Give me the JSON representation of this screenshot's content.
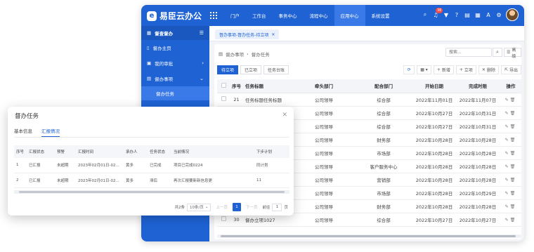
{
  "app": {
    "brand": "易臣云办公",
    "logo_letter": "e",
    "nav": [
      "门户",
      "工作台",
      "事务中心",
      "流程中心",
      "应用中心",
      "系统设置"
    ],
    "nav_active_index": 4,
    "notification_count": "36"
  },
  "sidebar": {
    "head": "督查督办",
    "items": [
      {
        "label": "督办主页"
      },
      {
        "label": "我的审批"
      },
      {
        "label": "督办事项"
      }
    ],
    "sub_item": "督办任务"
  },
  "tabstrip": {
    "tab": "督办事项-督办任务-待立项"
  },
  "content": {
    "breadcrumb": [
      "督办事项",
      "督办任务"
    ],
    "search_placeholder": "搜索...",
    "advanced": "高级",
    "subtabs": [
      "待立项",
      "已立项",
      "任务台账"
    ],
    "actions": {
      "new": "新增",
      "establish": "立项",
      "delete": "删除",
      "export": "导出"
    },
    "columns": [
      "序号",
      "任务标题",
      "牵头部门",
      "配合部门",
      "开始日期",
      "完成时限",
      "操作"
    ],
    "rows": [
      {
        "seq": "21",
        "title": "任务标题任务标题",
        "lead": "公司领导",
        "coop": "综合部",
        "start": "2022年11月01日",
        "end": "2022年11月07日"
      },
      {
        "seq": "",
        "title": "",
        "lead": "公司领导",
        "coop": "综合部",
        "start": "2022年10月27日",
        "end": "2022年10月31日"
      },
      {
        "seq": "",
        "title": "",
        "lead": "公司领导",
        "coop": "综合部",
        "start": "2022年10月27日",
        "end": "2022年10月31日"
      },
      {
        "seq": "",
        "title": "",
        "lead": "公司领导",
        "coop": "财务部",
        "start": "2022年10月28日",
        "end": "2022年10月28日"
      },
      {
        "seq": "",
        "title": "",
        "lead": "公司领导",
        "coop": "市场部",
        "start": "2022年10月28日",
        "end": "2022年10月28日"
      },
      {
        "seq": "",
        "title": "",
        "lead": "公司领导",
        "coop": "客户服务中心",
        "start": "2022年10月28日",
        "end": "2022年10月28日"
      },
      {
        "seq": "",
        "title": "",
        "lead": "公司领导",
        "coop": "营销部",
        "start": "2022年10月28日",
        "end": "2022年10月28日"
      },
      {
        "seq": "",
        "title": "",
        "lead": "公司领导",
        "coop": "市场部",
        "start": "2022年10月28日",
        "end": "2022年10月29日"
      },
      {
        "seq": "",
        "title": "",
        "lead": "公司领导",
        "coop": "财务部",
        "start": "2022年10月28日",
        "end": "2022年10月28日"
      },
      {
        "seq": "30",
        "title": "督办立项1027",
        "lead": "公司领导",
        "coop": "综合部",
        "start": "2022年10月27日",
        "end": "2022年10月27日"
      }
    ]
  },
  "dialog": {
    "title": "督办任务",
    "tabs": [
      "基本信息",
      "汇报情况"
    ],
    "active_tab": 1,
    "columns": [
      "序号",
      "汇报状态",
      "预警",
      "汇报时间",
      "承办人",
      "任务状态",
      "当前情况",
      "下步计划"
    ],
    "rows": [
      {
        "seq": "1",
        "state": "已汇报",
        "warn": "未超期",
        "time": "2023年02月01日-02...",
        "person": "黄多",
        "task": "已完成",
        "now": "项目已完成0224",
        "plan": "同计划"
      },
      {
        "seq": "2",
        "state": "已汇报",
        "warn": "未超期",
        "time": "2023年02月01日-02...",
        "person": "黄多",
        "task": "滞后",
        "now": "再次汇报要新新信息更",
        "plan": "11"
      }
    ],
    "pager": {
      "total": "共2条",
      "page_size": "10条/页",
      "prev": "上一页",
      "current": "1",
      "next": "下一页",
      "goto": "前往",
      "goto_value": "1",
      "page_unit": "页"
    }
  }
}
